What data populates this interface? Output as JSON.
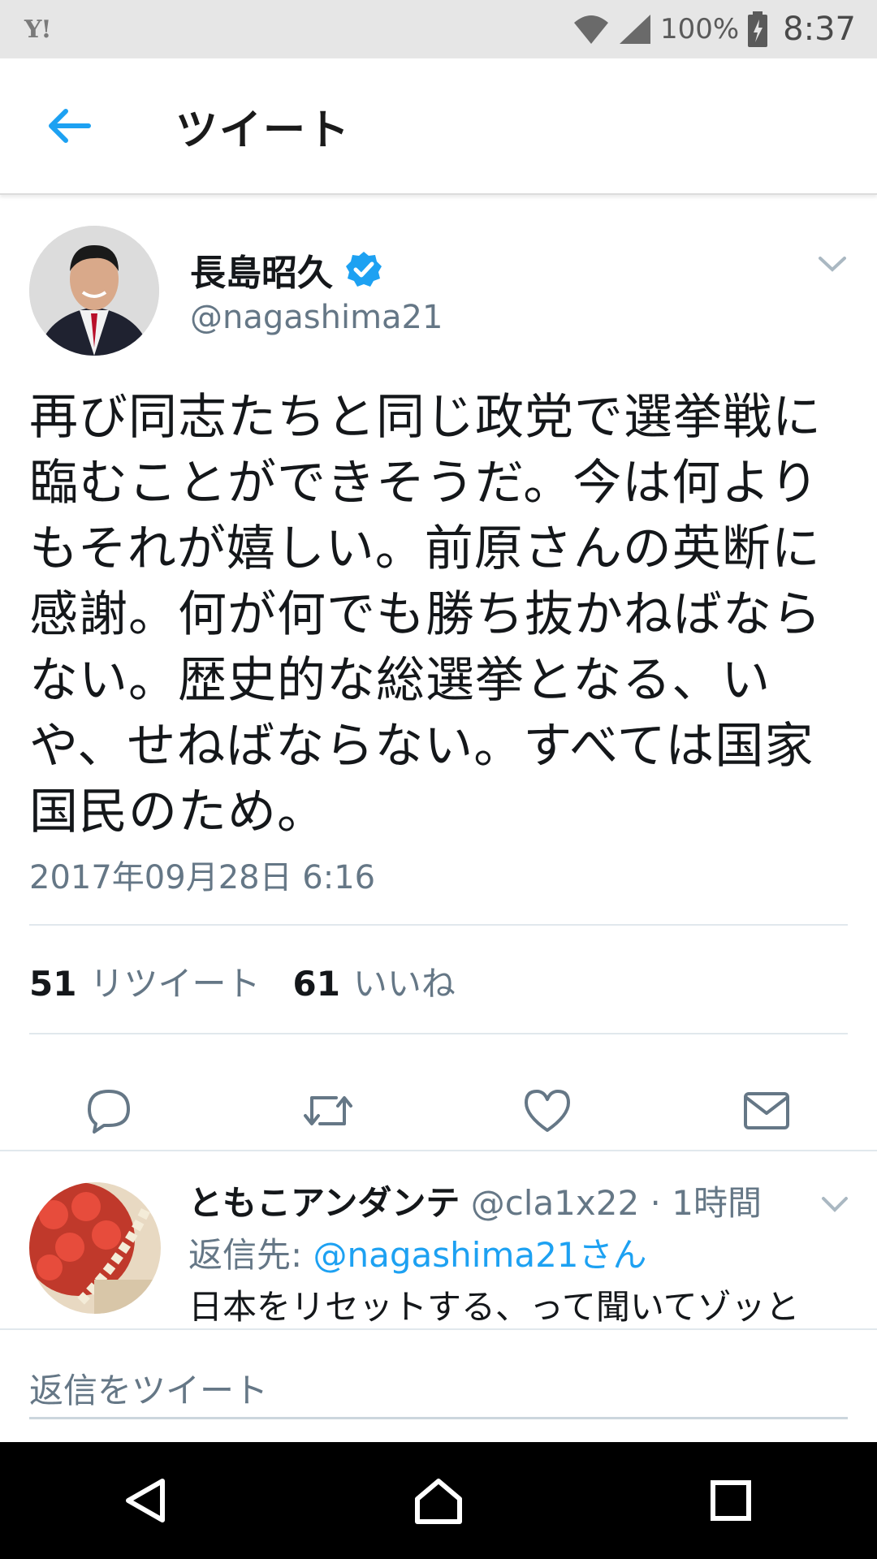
{
  "status_bar": {
    "carrier_icon": "Y!",
    "battery": "100%",
    "time": "8:37"
  },
  "header": {
    "title": "ツイート",
    "back_icon": "arrow-left-icon",
    "accent_color": "#1da1f2"
  },
  "tweet": {
    "author_name": "長島昭久",
    "verified": true,
    "handle": "@nagashima21",
    "text": "再び同志たちと同じ政党で選挙戦に臨むことができそうだ。今は何よりもそれが嬉しい。前原さんの英断に感謝。何が何でも勝ち抜かねばならない。歴史的な総選挙となる、いや、せねばならない。すべては国家国民のため。",
    "timestamp": "2017年09月28日 6:16",
    "retweet_count": "51",
    "retweet_label": "リツイート",
    "like_count": "61",
    "like_label": "いいね",
    "actions": [
      "reply-icon",
      "retweet-icon",
      "like-icon",
      "dm-icon"
    ]
  },
  "reply": {
    "name": "ともこアンダンテ",
    "meta": "@cla1x22 · 1時間",
    "reply_to_label": "返信先: ",
    "reply_to_handle": "@nagashima21さん",
    "text": "日本をリセットする、って聞いてゾッと"
  },
  "compose": {
    "placeholder": "返信をツイート"
  },
  "nav_bar": {
    "buttons": [
      "back-triangle-icon",
      "home-icon",
      "recents-icon"
    ]
  }
}
